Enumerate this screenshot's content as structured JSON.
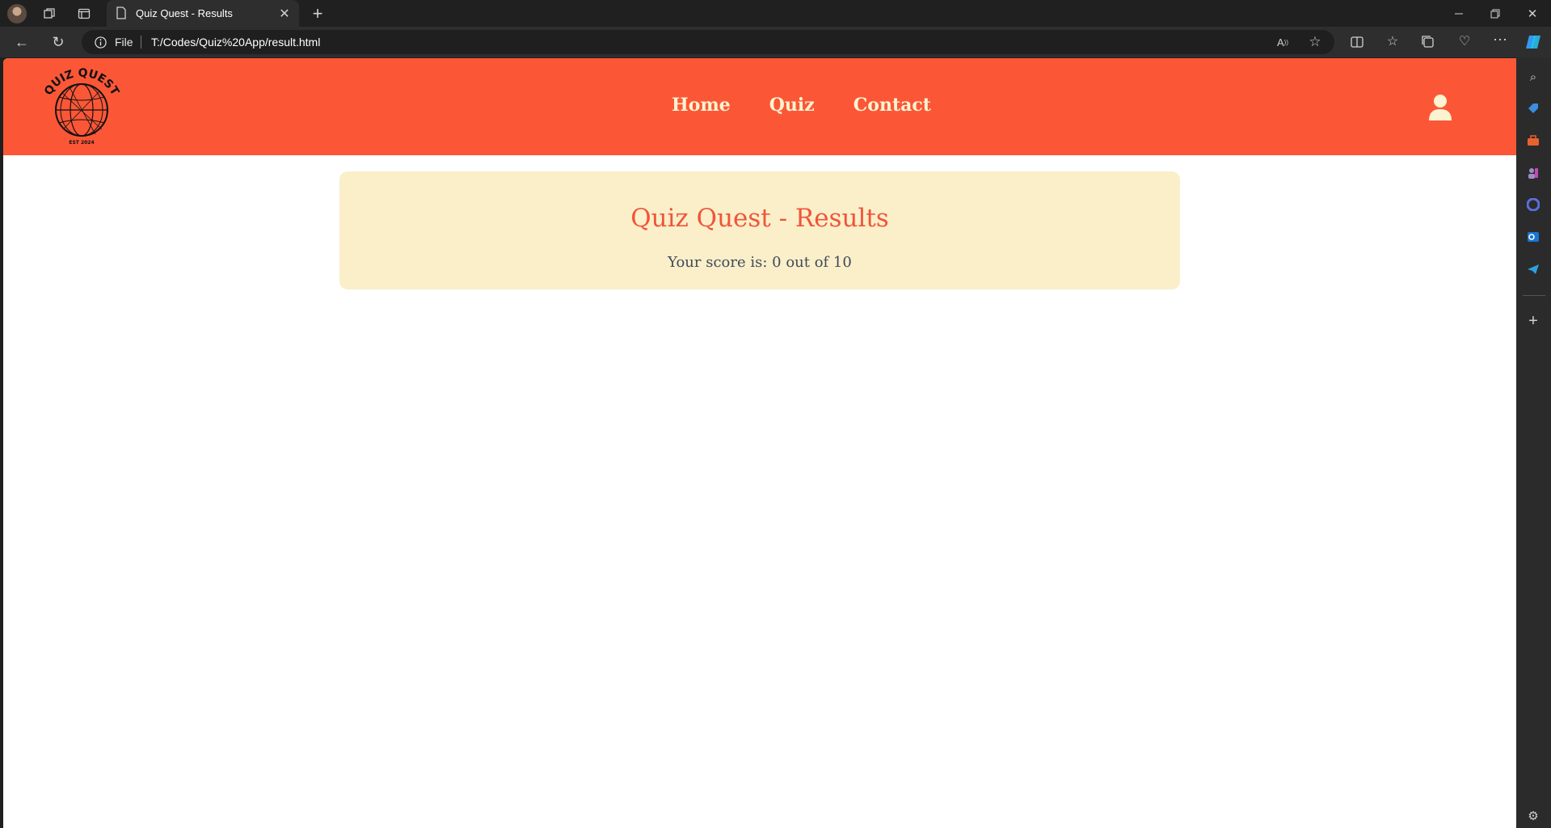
{
  "browser": {
    "tab_title": "Quiz Quest - Results",
    "address_scheme": "File",
    "address_url": "T:/Codes/Quiz%20App/result.html"
  },
  "site": {
    "logo_text": "QUIZ QUEST",
    "logo_subtext": "EST 2024",
    "nav": [
      "Home",
      "Quiz",
      "Contact"
    ],
    "brand_color": "#fb5737"
  },
  "result": {
    "title": "Quiz Quest - Results",
    "score_text": "Your score is: 0 out of 10"
  }
}
